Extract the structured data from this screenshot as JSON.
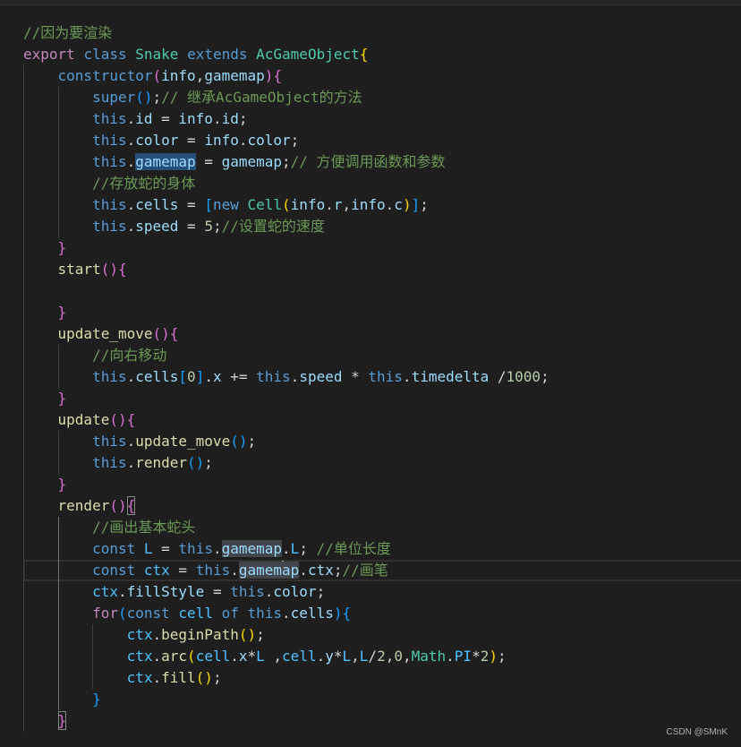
{
  "editor": {
    "theme": {
      "background": "#1e1e1e",
      "keyword": "#569cd6",
      "control": "#c586c0",
      "type": "#4ec9b0",
      "variable": "#9cdcfe",
      "constant": "#4fc1ff",
      "function": "#dcdcaa",
      "number": "#b5cea8",
      "punct": "#d4d4d4",
      "comment": "#6a9955",
      "bracket1": "#ffd700",
      "bracket2": "#da70d6",
      "bracket3": "#179fff",
      "selection": "#264f78",
      "wordHighlight": "#42464c",
      "cursor": "#aeafad",
      "indentGuide": "#404040",
      "activeIndentGuide": "#707070",
      "currentLineBorder": "#303030",
      "matchedBracketBorder": "#888888",
      "watermark": "#b0b0b0"
    },
    "lines": [
      {
        "ind": "",
        "tokens": [
          [
            "comment",
            "//因为要渲染"
          ]
        ]
      },
      {
        "ind": "",
        "tokens": [
          [
            "control",
            "export"
          ],
          [
            "punct",
            " "
          ],
          [
            "keyword",
            "class"
          ],
          [
            "punct",
            " "
          ],
          [
            "type",
            "Snake"
          ],
          [
            "punct",
            " "
          ],
          [
            "keyword",
            "extends"
          ],
          [
            "punct",
            " "
          ],
          [
            "type",
            "AcGameObject"
          ],
          [
            "bracket1",
            "{"
          ]
        ]
      },
      {
        "ind": "    ",
        "tokens": [
          [
            "keyword",
            "constructor"
          ],
          [
            "bracket2",
            "("
          ],
          [
            "variable",
            "info"
          ],
          [
            "punct",
            ","
          ],
          [
            "variable",
            "gamemap"
          ],
          [
            "bracket2",
            ")"
          ],
          [
            "bracket2",
            "{"
          ]
        ]
      },
      {
        "ind": "        ",
        "tokens": [
          [
            "keyword",
            "super"
          ],
          [
            "bracket3",
            "()"
          ],
          [
            "punct",
            ";"
          ],
          [
            "comment",
            "// 继承AcGameObject的方法"
          ]
        ]
      },
      {
        "ind": "        ",
        "tokens": [
          [
            "keyword",
            "this"
          ],
          [
            "punct",
            "."
          ],
          [
            "variable",
            "id"
          ],
          [
            "punct",
            " = "
          ],
          [
            "variable",
            "info"
          ],
          [
            "punct",
            "."
          ],
          [
            "variable",
            "id"
          ],
          [
            "punct",
            ";"
          ]
        ]
      },
      {
        "ind": "        ",
        "tokens": [
          [
            "keyword",
            "this"
          ],
          [
            "punct",
            "."
          ],
          [
            "variable",
            "color"
          ],
          [
            "punct",
            " = "
          ],
          [
            "variable",
            "info"
          ],
          [
            "punct",
            "."
          ],
          [
            "variable",
            "color"
          ],
          [
            "punct",
            ";"
          ]
        ]
      },
      {
        "ind": "        ",
        "tokens": [
          [
            "keyword",
            "this"
          ],
          [
            "punct",
            "."
          ],
          [
            "variable",
            "gamemap",
            "sel"
          ],
          [
            "punct",
            " = "
          ],
          [
            "variable",
            "gamemap"
          ],
          [
            "punct",
            ";"
          ],
          [
            "comment",
            "// 方便调用函数和参数"
          ]
        ]
      },
      {
        "ind": "        ",
        "tokens": [
          [
            "comment",
            "//存放蛇的身体"
          ]
        ]
      },
      {
        "ind": "        ",
        "tokens": [
          [
            "keyword",
            "this"
          ],
          [
            "punct",
            "."
          ],
          [
            "variable",
            "cells"
          ],
          [
            "punct",
            " = "
          ],
          [
            "bracket3",
            "["
          ],
          [
            "keyword",
            "new"
          ],
          [
            "punct",
            " "
          ],
          [
            "type",
            "Cell"
          ],
          [
            "bracket1",
            "("
          ],
          [
            "variable",
            "info"
          ],
          [
            "punct",
            "."
          ],
          [
            "variable",
            "r"
          ],
          [
            "punct",
            ","
          ],
          [
            "variable",
            "info"
          ],
          [
            "punct",
            "."
          ],
          [
            "variable",
            "c"
          ],
          [
            "bracket1",
            ")"
          ],
          [
            "bracket3",
            "]"
          ],
          [
            "punct",
            ";"
          ]
        ]
      },
      {
        "ind": "        ",
        "tokens": [
          [
            "keyword",
            "this"
          ],
          [
            "punct",
            "."
          ],
          [
            "variable",
            "speed"
          ],
          [
            "punct",
            " = "
          ],
          [
            "number",
            "5"
          ],
          [
            "punct",
            ";"
          ],
          [
            "comment",
            "//设置蛇的速度"
          ]
        ]
      },
      {
        "ind": "    ",
        "tokens": [
          [
            "bracket2",
            "}"
          ]
        ]
      },
      {
        "ind": "    ",
        "tokens": [
          [
            "function",
            "start"
          ],
          [
            "bracket2",
            "()"
          ],
          [
            "bracket2",
            "{"
          ]
        ]
      },
      {
        "ind": "",
        "tokens": []
      },
      {
        "ind": "    ",
        "tokens": [
          [
            "bracket2",
            "}"
          ]
        ]
      },
      {
        "ind": "    ",
        "tokens": [
          [
            "function",
            "update_move"
          ],
          [
            "bracket2",
            "()"
          ],
          [
            "bracket2",
            "{"
          ]
        ]
      },
      {
        "ind": "        ",
        "tokens": [
          [
            "comment",
            "//向右移动"
          ]
        ]
      },
      {
        "ind": "        ",
        "tokens": [
          [
            "keyword",
            "this"
          ],
          [
            "punct",
            "."
          ],
          [
            "variable",
            "cells"
          ],
          [
            "bracket3",
            "["
          ],
          [
            "number",
            "0"
          ],
          [
            "bracket3",
            "]"
          ],
          [
            "punct",
            "."
          ],
          [
            "variable",
            "x"
          ],
          [
            "punct",
            " += "
          ],
          [
            "keyword",
            "this"
          ],
          [
            "punct",
            "."
          ],
          [
            "variable",
            "speed"
          ],
          [
            "punct",
            " * "
          ],
          [
            "keyword",
            "this"
          ],
          [
            "punct",
            "."
          ],
          [
            "variable",
            "timedelta"
          ],
          [
            "punct",
            " /"
          ],
          [
            "number",
            "1000"
          ],
          [
            "punct",
            ";"
          ]
        ]
      },
      {
        "ind": "    ",
        "tokens": [
          [
            "bracket2",
            "}"
          ]
        ]
      },
      {
        "ind": "    ",
        "tokens": [
          [
            "function",
            "update"
          ],
          [
            "bracket2",
            "()"
          ],
          [
            "bracket2",
            "{"
          ]
        ]
      },
      {
        "ind": "        ",
        "tokens": [
          [
            "keyword",
            "this"
          ],
          [
            "punct",
            "."
          ],
          [
            "function",
            "update_move"
          ],
          [
            "bracket3",
            "()"
          ],
          [
            "punct",
            ";"
          ]
        ]
      },
      {
        "ind": "        ",
        "tokens": [
          [
            "keyword",
            "this"
          ],
          [
            "punct",
            "."
          ],
          [
            "function",
            "render"
          ],
          [
            "bracket3",
            "()"
          ],
          [
            "punct",
            ";"
          ]
        ]
      },
      {
        "ind": "    ",
        "tokens": [
          [
            "bracket2",
            "}"
          ]
        ]
      },
      {
        "ind": "    ",
        "tokens": [
          [
            "function",
            "render"
          ],
          [
            "bracket2",
            "()"
          ],
          [
            "bracket2",
            "{",
            "match"
          ]
        ]
      },
      {
        "ind": "        ",
        "tokens": [
          [
            "comment",
            "//画出基本蛇头"
          ]
        ]
      },
      {
        "ind": "        ",
        "tokens": [
          [
            "keyword",
            "const"
          ],
          [
            "punct",
            " "
          ],
          [
            "constant",
            "L"
          ],
          [
            "punct",
            " = "
          ],
          [
            "keyword",
            "this"
          ],
          [
            "punct",
            "."
          ],
          [
            "variable",
            "gamemap",
            "word"
          ],
          [
            "punct",
            "."
          ],
          [
            "constant",
            "L"
          ],
          [
            "punct",
            "; "
          ],
          [
            "comment",
            "//单位长度"
          ]
        ]
      },
      {
        "ind": "        ",
        "current": true,
        "tokens": [
          [
            "keyword",
            "const"
          ],
          [
            "punct",
            " "
          ],
          [
            "constant",
            "ctx"
          ],
          [
            "punct",
            " = "
          ],
          [
            "keyword",
            "this"
          ],
          [
            "punct",
            "."
          ],
          [
            "variable",
            "gamem",
            "word"
          ],
          [
            "cursor",
            ""
          ],
          [
            "variable",
            "ap",
            "word"
          ],
          [
            "punct",
            "."
          ],
          [
            "variable",
            "ctx"
          ],
          [
            "punct",
            ";"
          ],
          [
            "comment",
            "//画笔"
          ]
        ]
      },
      {
        "ind": "        ",
        "tokens": [
          [
            "constant",
            "ctx"
          ],
          [
            "punct",
            "."
          ],
          [
            "variable",
            "fillStyle"
          ],
          [
            "punct",
            " = "
          ],
          [
            "keyword",
            "this"
          ],
          [
            "punct",
            "."
          ],
          [
            "variable",
            "color"
          ],
          [
            "punct",
            ";"
          ]
        ]
      },
      {
        "ind": "        ",
        "tokens": [
          [
            "control",
            "for"
          ],
          [
            "bracket3",
            "("
          ],
          [
            "keyword",
            "const"
          ],
          [
            "punct",
            " "
          ],
          [
            "constant",
            "cell"
          ],
          [
            "punct",
            " "
          ],
          [
            "keyword",
            "of"
          ],
          [
            "punct",
            " "
          ],
          [
            "keyword",
            "this"
          ],
          [
            "punct",
            "."
          ],
          [
            "variable",
            "cells"
          ],
          [
            "bracket3",
            ")"
          ],
          [
            "bracket3",
            "{"
          ]
        ]
      },
      {
        "ind": "            ",
        "tokens": [
          [
            "constant",
            "ctx"
          ],
          [
            "punct",
            "."
          ],
          [
            "function",
            "beginPath"
          ],
          [
            "bracket1",
            "()"
          ],
          [
            "punct",
            ";"
          ]
        ]
      },
      {
        "ind": "            ",
        "tokens": [
          [
            "constant",
            "ctx"
          ],
          [
            "punct",
            "."
          ],
          [
            "function",
            "arc"
          ],
          [
            "bracket1",
            "("
          ],
          [
            "constant",
            "cell"
          ],
          [
            "punct",
            "."
          ],
          [
            "variable",
            "x"
          ],
          [
            "punct",
            "*"
          ],
          [
            "constant",
            "L"
          ],
          [
            "punct",
            " ,"
          ],
          [
            "constant",
            "cell"
          ],
          [
            "punct",
            "."
          ],
          [
            "variable",
            "y"
          ],
          [
            "punct",
            "*"
          ],
          [
            "constant",
            "L"
          ],
          [
            "punct",
            ","
          ],
          [
            "constant",
            "L"
          ],
          [
            "punct",
            "/"
          ],
          [
            "number",
            "2"
          ],
          [
            "punct",
            ","
          ],
          [
            "number",
            "0"
          ],
          [
            "punct",
            ","
          ],
          [
            "type",
            "Math"
          ],
          [
            "punct",
            "."
          ],
          [
            "constant",
            "PI"
          ],
          [
            "punct",
            "*"
          ],
          [
            "number",
            "2"
          ],
          [
            "bracket1",
            ")"
          ],
          [
            "punct",
            ";"
          ]
        ]
      },
      {
        "ind": "            ",
        "tokens": [
          [
            "constant",
            "ctx"
          ],
          [
            "punct",
            "."
          ],
          [
            "function",
            "fill"
          ],
          [
            "bracket1",
            "()"
          ],
          [
            "punct",
            ";"
          ]
        ]
      },
      {
        "ind": "        ",
        "tokens": [
          [
            "bracket3",
            "}"
          ]
        ]
      },
      {
        "ind": "    ",
        "tokens": [
          [
            "bracket2",
            "}",
            "match"
          ]
        ]
      }
    ]
  },
  "watermark": "CSDN @SMnK"
}
